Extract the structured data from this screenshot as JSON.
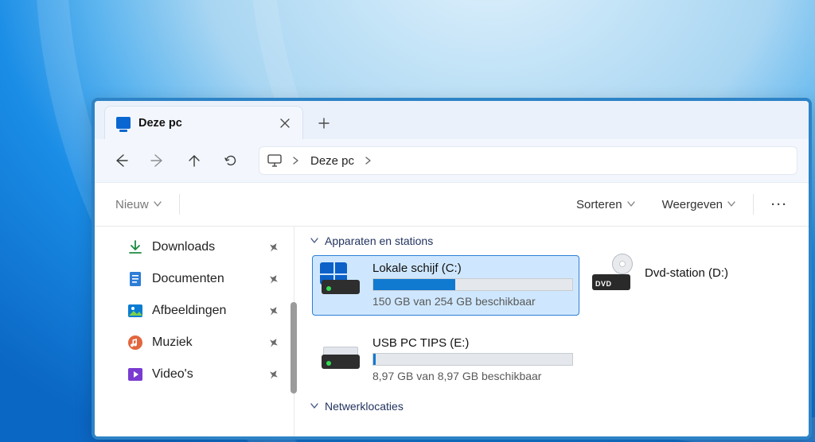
{
  "tab": {
    "title": "Deze pc"
  },
  "address": {
    "location": "Deze pc"
  },
  "toolbar": {
    "new": "Nieuw",
    "sort": "Sorteren",
    "view": "Weergeven"
  },
  "sidebar": {
    "items": [
      {
        "label": "Downloads",
        "icon": "download"
      },
      {
        "label": "Documenten",
        "icon": "document"
      },
      {
        "label": "Afbeeldingen",
        "icon": "pictures"
      },
      {
        "label": "Muziek",
        "icon": "music"
      },
      {
        "label": "Video's",
        "icon": "videos"
      }
    ]
  },
  "groups": {
    "devices": "Apparaten en stations",
    "network": "Netwerklocaties"
  },
  "drives": {
    "c": {
      "name": "Lokale schijf (C:)",
      "sub": "150 GB van 254 GB beschikbaar",
      "fill_percent": 41
    },
    "dvd": {
      "name": "Dvd-station (D:)",
      "badge": "DVD"
    },
    "e": {
      "name": "USB PC TIPS (E:)",
      "sub": "8,97 GB van 8,97 GB beschikbaar",
      "fill_percent": 1
    }
  }
}
